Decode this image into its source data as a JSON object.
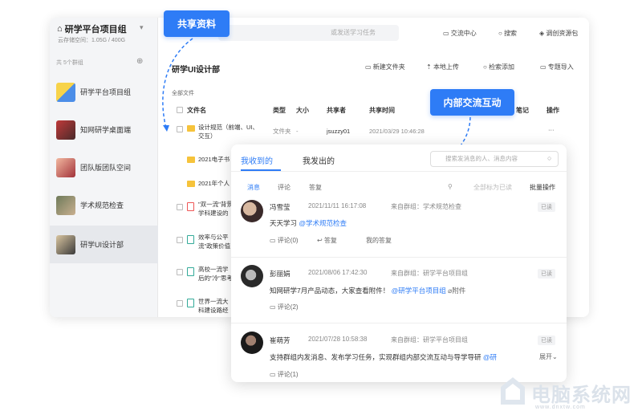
{
  "sidebar": {
    "title": "研学平台项目组",
    "storage": "云存储空间：1.05G / 400G",
    "groups_count": "共 5个群组",
    "groups": [
      {
        "label": "研学平台项目组",
        "active": false
      },
      {
        "label": "知网研学桌面端",
        "active": false
      },
      {
        "label": "团队版团队空间",
        "active": false
      },
      {
        "label": "学术规范检查",
        "active": false
      },
      {
        "label": "研学UI设计部",
        "active": true
      }
    ]
  },
  "topbar": {
    "search_placeholder": "或发送学习任务",
    "links": [
      "交流中心",
      "搜索",
      "调创资源包"
    ]
  },
  "folder": {
    "title": "研学UI设计部",
    "toolbar": [
      "新建文件夹",
      "本地上传",
      "检索添加",
      "专题导入"
    ],
    "breadcrumb": "全部文件",
    "columns": [
      "文件名",
      "类型",
      "大小",
      "共享者",
      "共享时间",
      "笔记",
      "操作"
    ],
    "rows": [
      {
        "name_line1": "设计规范（前端、UI、",
        "name_line2": "交互）",
        "type": "文件夹",
        "size": "-",
        "sharer": "jsuzzy01",
        "time": "2021/03/29 10:46:28",
        "more": "···"
      },
      {
        "name_line1": "2021电子书",
        "name_line2": ""
      },
      {
        "name_line1": "2021年个人",
        "name_line2": ""
      },
      {
        "name_line1": "\"双一流\"背景",
        "name_line2": "学科建设的"
      },
      {
        "name_line1": "效率与公平",
        "name_line2": "流\"政策价值"
      },
      {
        "name_line1": "高校一流学",
        "name_line2": "后的\"冷\"思考"
      },
      {
        "name_line1": "世界一流大",
        "name_line2": "科建设路经"
      }
    ]
  },
  "callouts": {
    "shared": "共享资料",
    "internal": "内部交流互动"
  },
  "panel": {
    "tabs": [
      "我收到的",
      "我发出的"
    ],
    "search_placeholder": "搜索发消息的人、消息内容",
    "sub_tabs": [
      "消息",
      "评论",
      "答复"
    ],
    "mark_all_read": "全部标为已读",
    "batch": "批量操作",
    "messages": [
      {
        "name": "冯雪莹",
        "time": "2021/11/11 16:17:08",
        "source": "来自群组：学术规范检查",
        "status": "已读",
        "text": "天天学习 ",
        "mention": "@学术规范检查",
        "actions": [
          "评论(0)",
          "答复",
          "我的答复"
        ]
      },
      {
        "name": "彭丽娟",
        "time": "2021/08/06 17:42:30",
        "source": "来自群组：研学平台项目组",
        "status": "已读",
        "text": "知网研学7月产品动态，大家查看附件！",
        "mention": "@研学平台项目组",
        "attachment": "附件",
        "actions": [
          "评论(2)"
        ]
      },
      {
        "name": "崔萌芳",
        "time": "2021/07/28 10:58:38",
        "source": "来自群组：研学平台项目组",
        "status": "已读",
        "text": "支持群组内发消息、发布学习任务，实现群组内部交流互动与导学导研",
        "mention": "@研",
        "expand": "展开",
        "actions": [
          "评论(1)"
        ]
      }
    ]
  },
  "watermark": {
    "text": "电脑系统网",
    "url": "www.dnxtw.com"
  },
  "colors": {
    "accent": "#2e7cf6",
    "folder": "#f6c33b"
  }
}
